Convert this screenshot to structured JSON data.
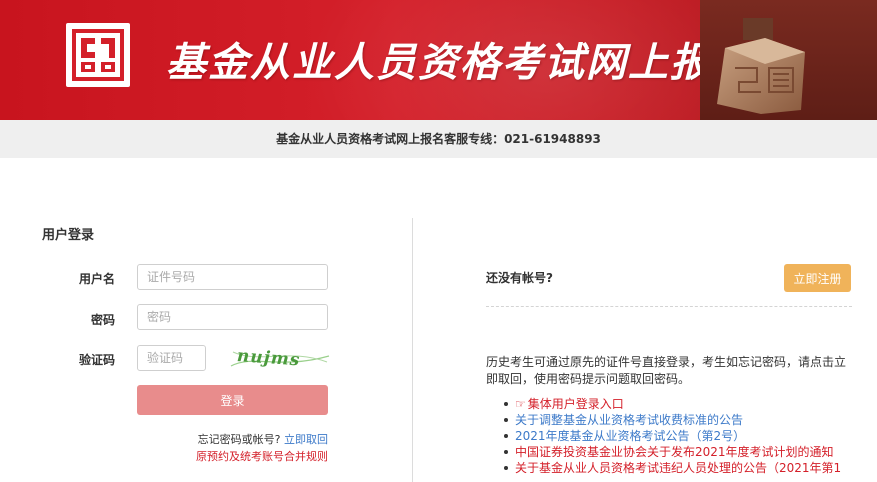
{
  "banner": {
    "title": "基金从业人员资格考试网上报名"
  },
  "hotline": {
    "text": "基金从业人员资格考试网上报名客服专线：021-61948893"
  },
  "login": {
    "title": "用户登录",
    "username_label": "用户名",
    "username_placeholder": "证件号码",
    "password_label": "密码",
    "password_placeholder": "密码",
    "captcha_label": "验证码",
    "captcha_placeholder": "验证码",
    "captcha_text": "nujms",
    "submit_label": "登录",
    "forgot_text": "忘记密码或帐号?",
    "forgot_link": "立即取回",
    "merge_link": "原预约及统考账号合并规则"
  },
  "register": {
    "no_account_text": "还没有帐号?",
    "register_button": "立即注册",
    "description": "历史考生可通过原先的证件号直接登录，考生如忘记密码，请点击立即取回，使用密码提示问题取回密码。"
  },
  "notices": [
    {
      "icon": "hand-pointer-icon",
      "text": "集体用户登录入口",
      "color": "#d4202a"
    },
    {
      "text": "关于调整基金从业资格考试收费标准的公告",
      "color": "#3d7ac9"
    },
    {
      "text": "2021年度基金从业资格考试公告（第2号）",
      "color": "#3d7ac9"
    },
    {
      "text": "中国证券投资基金业协会关于发布2021年度考试计划的通知",
      "color": "#d4202a"
    },
    {
      "text": "关于基金从业人员资格考试违纪人员处理的公告（2021年第1",
      "color": "#d4202a"
    }
  ],
  "colors": {
    "banner_red": "#d4202a",
    "login_button": "#e88c8c",
    "register_button": "#f0b35a",
    "link_blue": "#3d7ac9",
    "link_red": "#d4202a"
  }
}
